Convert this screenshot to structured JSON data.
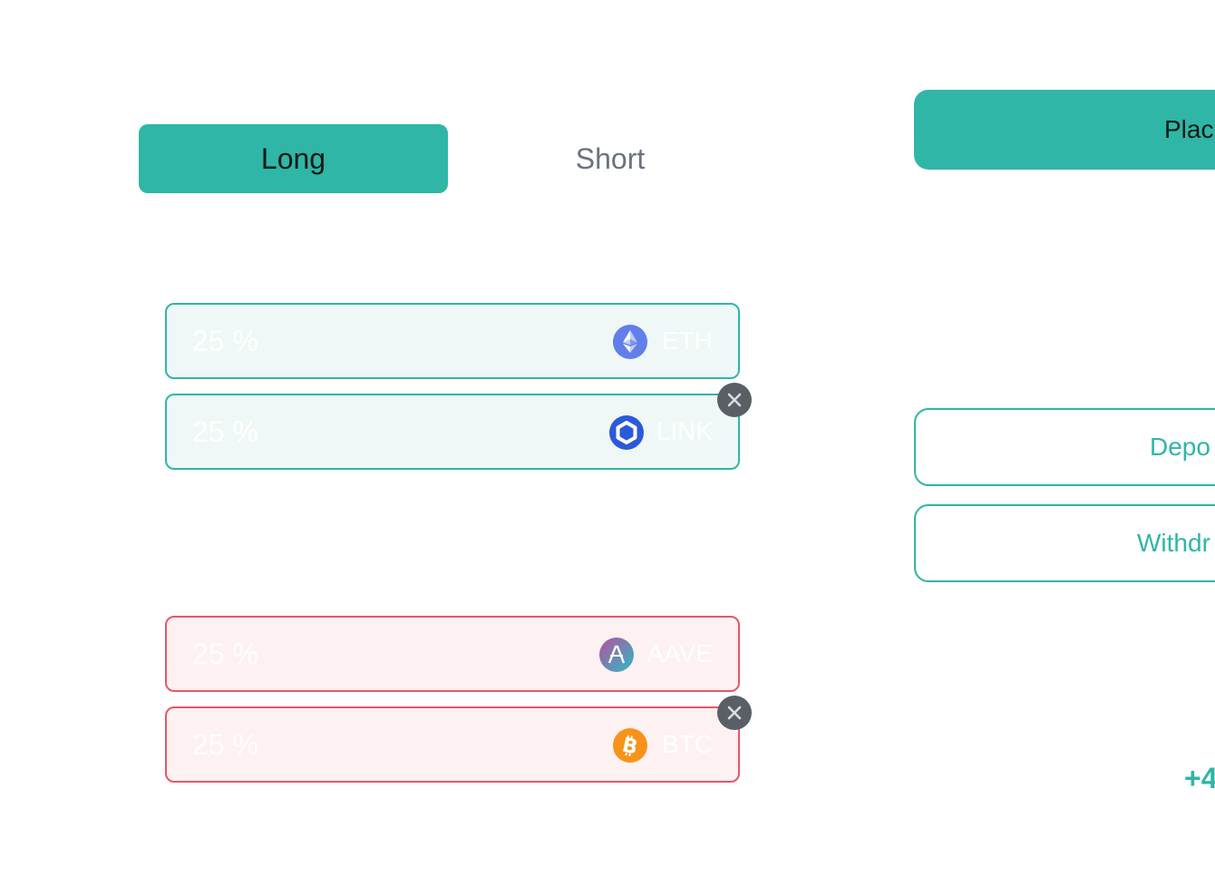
{
  "tabs": {
    "long_label": "Long",
    "short_label": "Short",
    "active": "Long"
  },
  "long_assets": [
    {
      "percent": "25 %",
      "ticker": "ETH",
      "icon": "eth-icon"
    },
    {
      "percent": "25 %",
      "ticker": "LINK",
      "icon": "link-icon"
    }
  ],
  "short_assets": [
    {
      "percent": "25 %",
      "ticker": "AAVE",
      "icon": "aave-icon"
    },
    {
      "percent": "25 %",
      "ticker": "BTC",
      "icon": "btc-icon"
    }
  ],
  "actions": {
    "place_label": "Plac",
    "deposit_label": "Depo",
    "withdraw_label": "Withdr"
  },
  "pnl_text": "+4",
  "colors": {
    "accent": "#2fb6a6",
    "short_border": "#e9556a",
    "long_bg": "#eff8f6",
    "short_bg": "#fdf1f2",
    "remove_btn": "#5a5f66"
  }
}
